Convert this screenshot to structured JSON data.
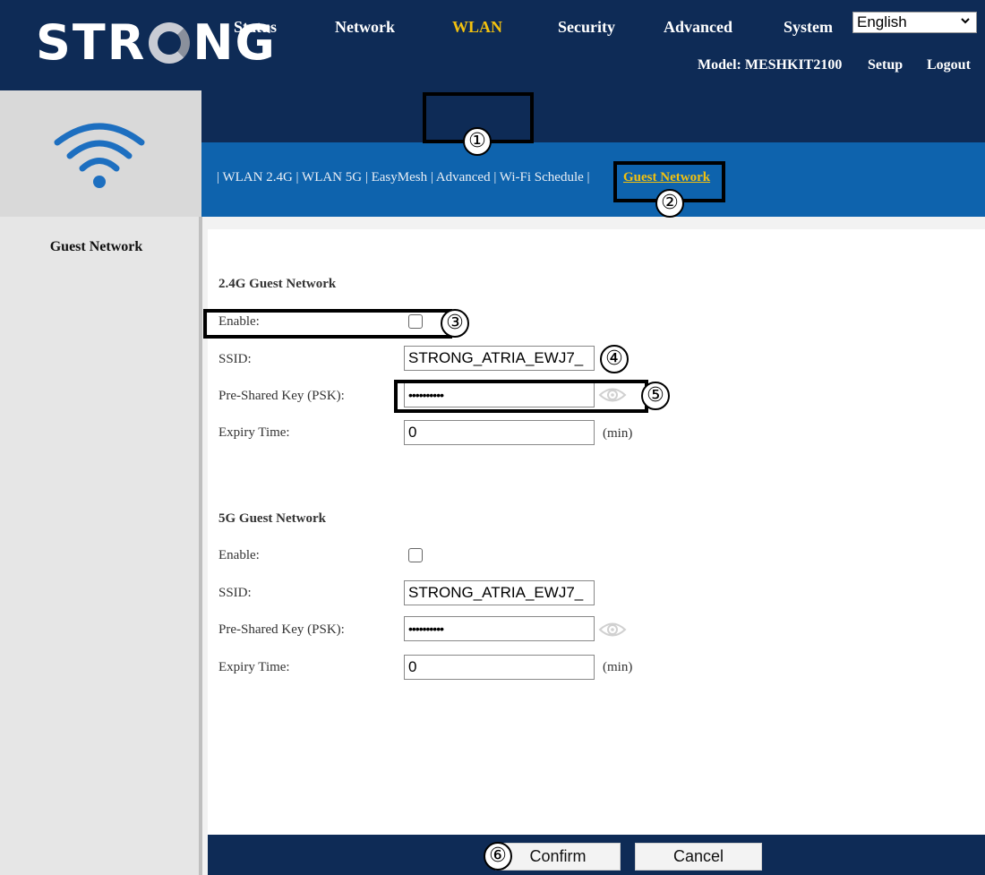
{
  "header": {
    "logo_text_left": "STR",
    "logo_text_right": "NG",
    "language_select": "English",
    "model_label": "Model: MESHKIT2100",
    "setup_link": "Setup",
    "logout_link": "Logout"
  },
  "sidebar": {
    "icon": "wifi-icon",
    "title": "Guest Network"
  },
  "top_nav": {
    "items": [
      {
        "label": "Status",
        "active": false
      },
      {
        "label": "Network",
        "active": false
      },
      {
        "label": "WLAN",
        "active": true
      },
      {
        "label": "Security",
        "active": false
      },
      {
        "label": "Advanced",
        "active": false
      },
      {
        "label": "System",
        "active": false
      }
    ]
  },
  "sub_nav": {
    "links_text": "| WLAN 2.4G | WLAN 5G | EasyMesh | Advanced | Wi-Fi Schedule |",
    "active_label": "Guest Network"
  },
  "sections": [
    {
      "title": "2.4G Guest Network",
      "enable_label": "Enable:",
      "enable_checked": false,
      "ssid_label": "SSID:",
      "ssid_value": "STRONG_ATRIA_EWJ7_",
      "psk_label": "Pre-Shared Key (PSK):",
      "psk_value": "••••••••••",
      "expiry_label": "Expiry Time:",
      "expiry_value": "0",
      "expiry_unit": "(min)"
    },
    {
      "title": "5G Guest Network",
      "enable_label": "Enable:",
      "enable_checked": false,
      "ssid_label": "SSID:",
      "ssid_value": "STRONG_ATRIA_EWJ7_",
      "psk_label": "Pre-Shared Key (PSK):",
      "psk_value": "••••••••••",
      "expiry_label": "Expiry Time:",
      "expiry_value": "0",
      "expiry_unit": "(min)"
    }
  ],
  "footer": {
    "confirm_label": "Confirm",
    "cancel_label": "Cancel"
  },
  "annotations": [
    "①",
    "②",
    "③",
    "④",
    "⑤",
    "⑥"
  ],
  "colors": {
    "header_bg": "#0e2b56",
    "subnav_bg": "#0e63ad",
    "active_accent": "#f2c10f",
    "wifi_icon": "#1d6fc0"
  }
}
